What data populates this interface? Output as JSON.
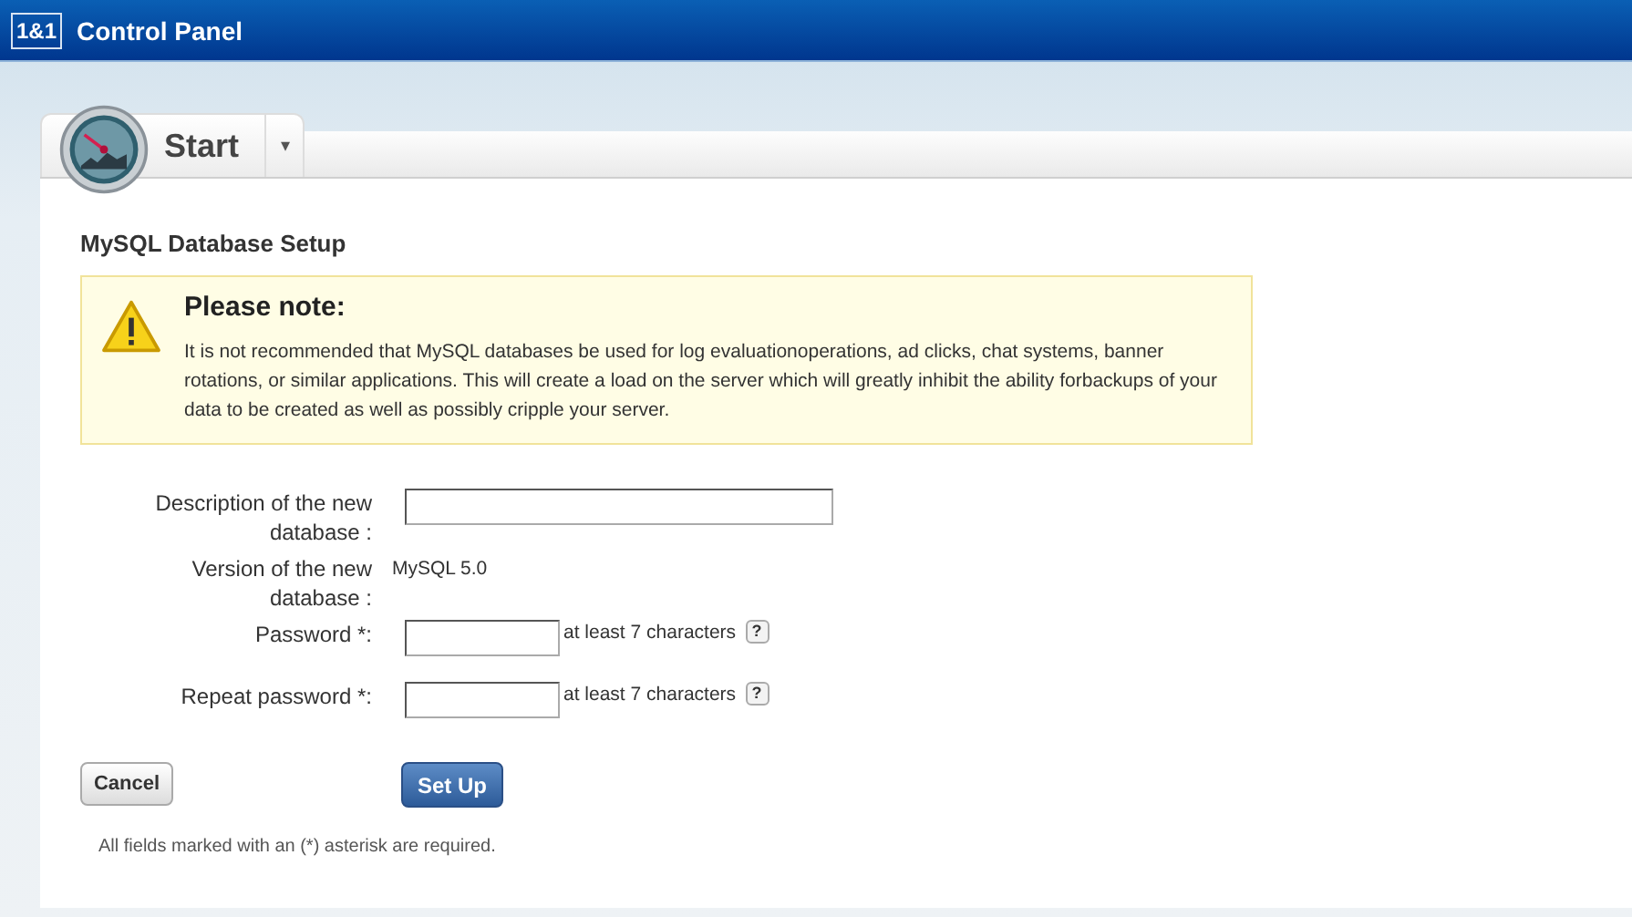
{
  "header": {
    "logo": "1&1",
    "title": "Control Panel"
  },
  "tab": {
    "label": "Start",
    "menu_glyph": "▾"
  },
  "page_title": "MySQL Database Setup",
  "notice": {
    "title": "Please note:",
    "text": "It is not recommended that MySQL databases be used for log evaluationoperations, ad clicks, chat systems, banner rotations, or similar applications. This will create a load on the server which will greatly inhibit the ability forbackups of your data to be created as well as possibly cripple your server."
  },
  "fields": [
    {
      "kind": "text",
      "label": "Description of the new database :"
    },
    {
      "kind": "static",
      "label": "Version of the new database :",
      "value": "MySQL 5.0"
    },
    {
      "kind": "password",
      "label": "Password *:",
      "hint": "at least 7 characters",
      "help": "?"
    },
    {
      "kind": "password",
      "label": "Repeat password *:",
      "hint": "at least 7 characters",
      "help": "?"
    }
  ],
  "buttons": {
    "cancel": "Cancel",
    "submit": "Set Up"
  },
  "footnote": "All fields marked with an (*) asterisk are required."
}
